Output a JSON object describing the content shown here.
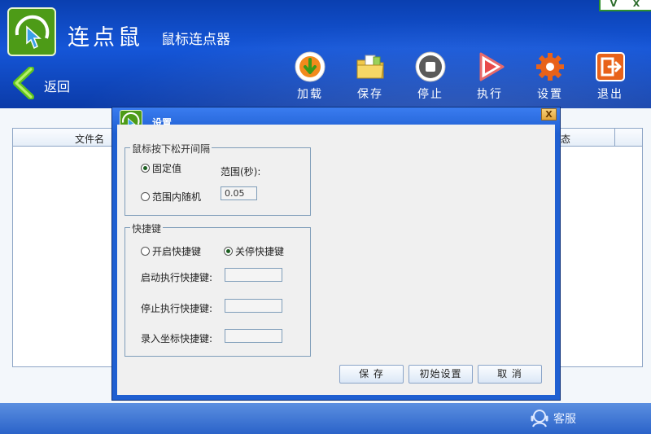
{
  "app": {
    "title": "连点鼠",
    "subtitle": "鼠标连点器",
    "back_label": "返回"
  },
  "window_controls": {
    "minimize": "V",
    "close": "X"
  },
  "toolbar": {
    "load": "加载",
    "save": "保存",
    "stop": "停止",
    "run": "执行",
    "settings": "设置",
    "exit": "退出"
  },
  "table": {
    "col_filename": "文件名",
    "col_status_partial": "态"
  },
  "footer": {
    "support": "客服"
  },
  "dialog": {
    "title": "设置",
    "close": "X",
    "interval_group": {
      "legend": "鼠标按下松开间隔",
      "fixed": "固定值",
      "random": "范围内随机",
      "range_label": "范围(秒):",
      "range_value": "0.05",
      "selected": "fixed"
    },
    "hotkey_group": {
      "legend": "快捷键",
      "enable": "开启快捷键",
      "disable": "关停快捷键",
      "selected": "disable",
      "start_label": "启动执行快捷键:",
      "stop_label": "停止执行快捷键:",
      "record_label": "录入坐标快捷键:",
      "start_value": "",
      "stop_value": "",
      "record_value": ""
    },
    "buttons": {
      "save": "保 存",
      "reset": "初始设置",
      "cancel": "取 消"
    }
  },
  "colors": {
    "header_blue": "#1556d8",
    "dialog_blue": "#1f5fd1",
    "brand_green": "#4d9b17"
  }
}
